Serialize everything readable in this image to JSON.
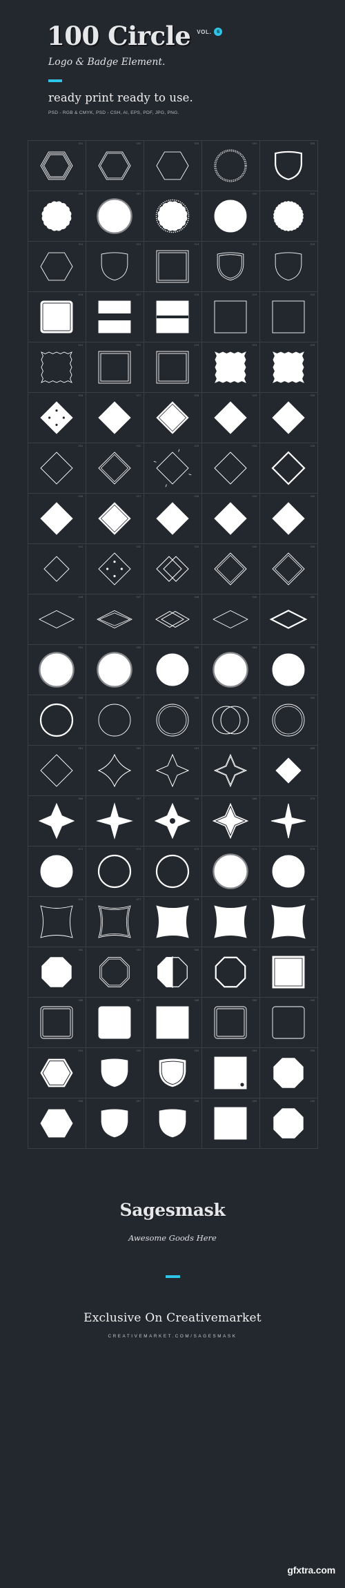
{
  "header": {
    "title": "100 Circle",
    "vol_label": "VOL.",
    "vol_number": "6",
    "subtitle": "Logo & Badge Element.",
    "tagline": "ready print ready to use.",
    "formats": "PSD - RGB & CMYK, PSD - CSH, AI, EPS, PDF, JPG, PNG."
  },
  "footer": {
    "brand": "Sagesmask",
    "brand_sub": "Awesome Goods Here",
    "exclusive": "Exclusive On Creativemarket",
    "url": "CREATIVEMARKET.COM/SAGESMASK"
  },
  "watermark": "gfxtra.com",
  "colors": {
    "background": "#23272e",
    "accent": "#2ec4e6",
    "shape": "#ffffff",
    "grid_line": "#3a3f47",
    "text": "#e8e8e8"
  },
  "grid": {
    "columns": 5,
    "rows": 20,
    "total": 100,
    "cells": [
      {
        "num": "001",
        "shape": "hexagon",
        "style": "triple-outline"
      },
      {
        "num": "002",
        "shape": "hexagon",
        "style": "double-outline"
      },
      {
        "num": "003",
        "shape": "hexagon",
        "style": "outline"
      },
      {
        "num": "004",
        "shape": "circle",
        "style": "rope-outline"
      },
      {
        "num": "005",
        "shape": "shield",
        "style": "thick-outline"
      },
      {
        "num": "006",
        "shape": "scallop-circle",
        "style": "filled"
      },
      {
        "num": "007",
        "shape": "circle",
        "style": "filled-ring"
      },
      {
        "num": "008",
        "shape": "scallop-circle",
        "style": "filled-dotted"
      },
      {
        "num": "009",
        "shape": "circle",
        "style": "filled-soft"
      },
      {
        "num": "010",
        "shape": "circle",
        "style": "filled-scallop-edge"
      },
      {
        "num": "011",
        "shape": "hexagon",
        "style": "outline"
      },
      {
        "num": "012",
        "shape": "shield",
        "style": "outline"
      },
      {
        "num": "013",
        "shape": "square",
        "style": "double-outline"
      },
      {
        "num": "014",
        "shape": "shield",
        "style": "double-outline"
      },
      {
        "num": "015",
        "shape": "shield",
        "style": "outline"
      },
      {
        "num": "016",
        "shape": "rounded-square",
        "style": "filled-frame"
      },
      {
        "num": "017",
        "shape": "square",
        "style": "filled-banner"
      },
      {
        "num": "018",
        "shape": "square",
        "style": "filled-stripe"
      },
      {
        "num": "019",
        "shape": "square",
        "style": "outline-notch"
      },
      {
        "num": "020",
        "shape": "square",
        "style": "outline-round"
      },
      {
        "num": "021",
        "shape": "square",
        "style": "zigzag-outline"
      },
      {
        "num": "022",
        "shape": "square",
        "style": "double-outline"
      },
      {
        "num": "023",
        "shape": "square",
        "style": "outline-inner"
      },
      {
        "num": "024",
        "shape": "square",
        "style": "filled-zigzag"
      },
      {
        "num": "025",
        "shape": "square",
        "style": "filled-zigzag-bottom"
      },
      {
        "num": "026",
        "shape": "diamond",
        "style": "filled-dots"
      },
      {
        "num": "027",
        "shape": "diamond",
        "style": "filled-outline"
      },
      {
        "num": "028",
        "shape": "diamond",
        "style": "filled-double"
      },
      {
        "num": "029",
        "shape": "diamond",
        "style": "filled-thin"
      },
      {
        "num": "030",
        "shape": "diamond",
        "style": "filled-shadow"
      },
      {
        "num": "031",
        "shape": "diamond",
        "style": "outline"
      },
      {
        "num": "032",
        "shape": "diamond",
        "style": "outline-double"
      },
      {
        "num": "033",
        "shape": "diamond",
        "style": "outline-rays"
      },
      {
        "num": "034",
        "shape": "diamond",
        "style": "outline-rounded"
      },
      {
        "num": "035",
        "shape": "diamond",
        "style": "outline-thick"
      },
      {
        "num": "036",
        "shape": "diamond",
        "style": "filled"
      },
      {
        "num": "037",
        "shape": "diamond",
        "style": "filled-inner-line"
      },
      {
        "num": "038",
        "shape": "diamond",
        "style": "filled-soft"
      },
      {
        "num": "039",
        "shape": "diamond",
        "style": "filled-rounded"
      },
      {
        "num": "040",
        "shape": "diamond",
        "style": "filled-tilt"
      },
      {
        "num": "041",
        "shape": "diamond",
        "style": "outline-small"
      },
      {
        "num": "042",
        "shape": "diamond",
        "style": "outline-dots"
      },
      {
        "num": "043",
        "shape": "diamond",
        "style": "overlap-double"
      },
      {
        "num": "044",
        "shape": "diamond",
        "style": "outline-rounded-double"
      },
      {
        "num": "045",
        "shape": "diamond",
        "style": "outline-frame"
      },
      {
        "num": "046",
        "shape": "rhombus-wide",
        "style": "outline"
      },
      {
        "num": "047",
        "shape": "rhombus-wide",
        "style": "outline-double"
      },
      {
        "num": "048",
        "shape": "rhombus-wide",
        "style": "overlap"
      },
      {
        "num": "049",
        "shape": "rhombus-wide",
        "style": "outline-rounded"
      },
      {
        "num": "050",
        "shape": "rhombus-wide",
        "style": "outline-thick"
      },
      {
        "num": "051",
        "shape": "circle",
        "style": "filled-ring"
      },
      {
        "num": "052",
        "shape": "circle",
        "style": "filled-ring-thin"
      },
      {
        "num": "053",
        "shape": "circle",
        "style": "filled"
      },
      {
        "num": "054",
        "shape": "circle",
        "style": "filled-soft-ring"
      },
      {
        "num": "055",
        "shape": "circle",
        "style": "filled-plain"
      },
      {
        "num": "056",
        "shape": "circle",
        "style": "outline-thick"
      },
      {
        "num": "057",
        "shape": "circle",
        "style": "outline"
      },
      {
        "num": "058",
        "shape": "circle",
        "style": "outline-double"
      },
      {
        "num": "059",
        "shape": "circle",
        "style": "overlap-two"
      },
      {
        "num": "060",
        "shape": "circle",
        "style": "outline-inner"
      },
      {
        "num": "061",
        "shape": "diamond",
        "style": "outline-thin"
      },
      {
        "num": "062",
        "shape": "diamond",
        "style": "outline-concave"
      },
      {
        "num": "063",
        "shape": "diamond",
        "style": "outline-star4"
      },
      {
        "num": "064",
        "shape": "diamond",
        "style": "outline-star4-double"
      },
      {
        "num": "065",
        "shape": "diamond",
        "style": "filled-small"
      },
      {
        "num": "066",
        "shape": "star4",
        "style": "filled"
      },
      {
        "num": "067",
        "shape": "star4",
        "style": "filled-sharp"
      },
      {
        "num": "068",
        "shape": "star4",
        "style": "filled-concave"
      },
      {
        "num": "069",
        "shape": "star4",
        "style": "filled-outline"
      },
      {
        "num": "070",
        "shape": "star4",
        "style": "filled-slim"
      },
      {
        "num": "071",
        "shape": "circle",
        "style": "filled"
      },
      {
        "num": "072",
        "shape": "circle",
        "style": "outline-thick"
      },
      {
        "num": "073",
        "shape": "circle",
        "style": "outline-heavy"
      },
      {
        "num": "074",
        "shape": "circle",
        "style": "filled-ring"
      },
      {
        "num": "075",
        "shape": "circle",
        "style": "filled-soft"
      },
      {
        "num": "076",
        "shape": "square",
        "style": "concave-outline"
      },
      {
        "num": "077",
        "shape": "square",
        "style": "concave-double"
      },
      {
        "num": "078",
        "shape": "square",
        "style": "concave-filled"
      },
      {
        "num": "079",
        "shape": "square",
        "style": "concave-filled-outline"
      },
      {
        "num": "080",
        "shape": "square",
        "style": "concave-filled-thick"
      },
      {
        "num": "081",
        "shape": "octagon",
        "style": "filled"
      },
      {
        "num": "082",
        "shape": "octagon",
        "style": "outline-double"
      },
      {
        "num": "083",
        "shape": "octagon",
        "style": "half-filled"
      },
      {
        "num": "084",
        "shape": "octagon",
        "style": "outline-thick"
      },
      {
        "num": "085",
        "shape": "square",
        "style": "filled-frame-inner"
      },
      {
        "num": "086",
        "shape": "rounded-square",
        "style": "double-outline"
      },
      {
        "num": "087",
        "shape": "rounded-square",
        "style": "filled"
      },
      {
        "num": "088",
        "shape": "square",
        "style": "filled"
      },
      {
        "num": "089",
        "shape": "rounded-square",
        "style": "outline-inner"
      },
      {
        "num": "090",
        "shape": "rounded-square",
        "style": "outline"
      },
      {
        "num": "091",
        "shape": "hexagon",
        "style": "filled-outline"
      },
      {
        "num": "092",
        "shape": "shield",
        "style": "filled"
      },
      {
        "num": "093",
        "shape": "shield",
        "style": "filled-outline"
      },
      {
        "num": "094",
        "shape": "square",
        "style": "filled-dot"
      },
      {
        "num": "095",
        "shape": "octagon",
        "style": "filled"
      },
      {
        "num": "096",
        "shape": "hexagon",
        "style": "filled"
      },
      {
        "num": "097",
        "shape": "shield",
        "style": "filled-round"
      },
      {
        "num": "098",
        "shape": "shield",
        "style": "filled-pointed"
      },
      {
        "num": "099",
        "shape": "square",
        "style": "filled"
      },
      {
        "num": "100",
        "shape": "octagon",
        "style": "filled-wide"
      }
    ]
  }
}
